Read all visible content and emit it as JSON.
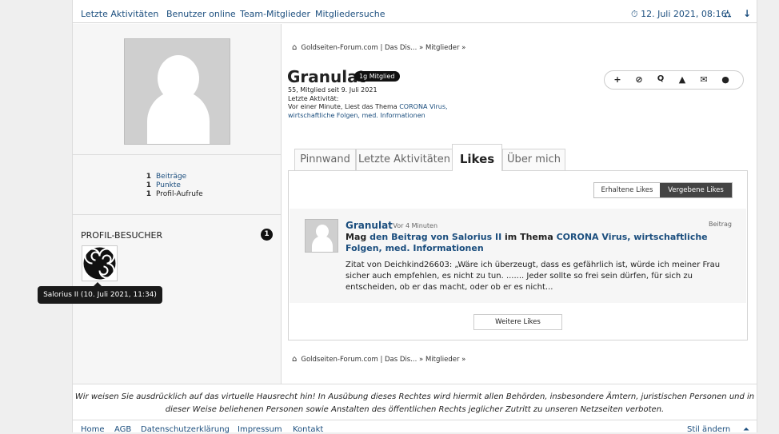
{
  "subnav": {
    "links": [
      "Letzte Aktivitäten",
      "Benutzer online",
      "Team-Mitglieder",
      "Mitgliedersuche"
    ],
    "datetime": "12. Juli 2021, 08:16",
    "clock_icon": "clock-icon",
    "sitemap_icon": "sitemap-icon",
    "down_icon": "arrow-down-icon"
  },
  "sidebar": {
    "stats": [
      {
        "n": "1",
        "label": "Beiträge"
      },
      {
        "n": "1",
        "label": "Punkte"
      },
      {
        "n": "1",
        "label": "Profil-Aufrufe"
      }
    ],
    "visitors_title": "PROFIL-BESUCHER",
    "visitors_count": "1",
    "tooltip": "Salorius II (10. Juli 2021, 11:34)"
  },
  "breadcrumb": {
    "site": "Goldseiten-Forum.com | Das Dis...",
    "sep": "»",
    "section": "Mitglieder",
    "end": "»"
  },
  "profile": {
    "name": "Granulat",
    "rank": "1g Mitglied",
    "since": "55, Mitglied seit 9. Juli 2021",
    "activity_label": "Letzte Aktivität:",
    "activity_text": "Vor einer Minute, Liest das Thema",
    "activity_link": "CORONA Virus, wirtschaftliche Folgen, med. Informationen"
  },
  "actions": [
    "+",
    "⊘",
    "🔍",
    "⚠",
    "✉",
    "💬"
  ],
  "tabs": [
    "Pinnwand",
    "Letzte Aktivitäten",
    "Likes",
    "Über mich"
  ],
  "likes_filter": {
    "received": "Erhaltene Likes",
    "given": "Vergebene Likes"
  },
  "like_item": {
    "user": "Granulat",
    "time": "- Vor 4 Minuten",
    "type": "Beitrag",
    "mag": "Mag",
    "post_link": "den Beitrag von Salorius II",
    "im_thema": "im Thema",
    "thread_link": "CORONA Virus, wirtschaftliche Folgen, med. Informationen",
    "quote": "Zitat von Deichkind26603: „Wäre ich überzeugt, dass es gefährlich ist, würde ich meiner Frau sicher auch empfehlen, es nicht zu tun. ....... Jeder sollte so frei sein dürfen, für sich zu entscheiden, ob er das macht, oder ob er es nicht..."
  },
  "more_likes": "Weitere Likes",
  "notice": "Wir weisen Sie ausdrücklich auf das virtuelle Hausrecht hin! In Ausübung dieses Rechtes wird hiermit allen Behörden, insbesondere Ämtern, juristischen Personen und in dieser Weise beliehenen Personen sowie Anstalten des öffentlichen Rechts jeglicher Zutritt zu unseren Netzseiten verboten.",
  "footer": {
    "links": [
      "Home",
      "AGB",
      "Datenschutzerklärung",
      "Impressum",
      "Kontakt"
    ],
    "style": "Stil ändern"
  }
}
